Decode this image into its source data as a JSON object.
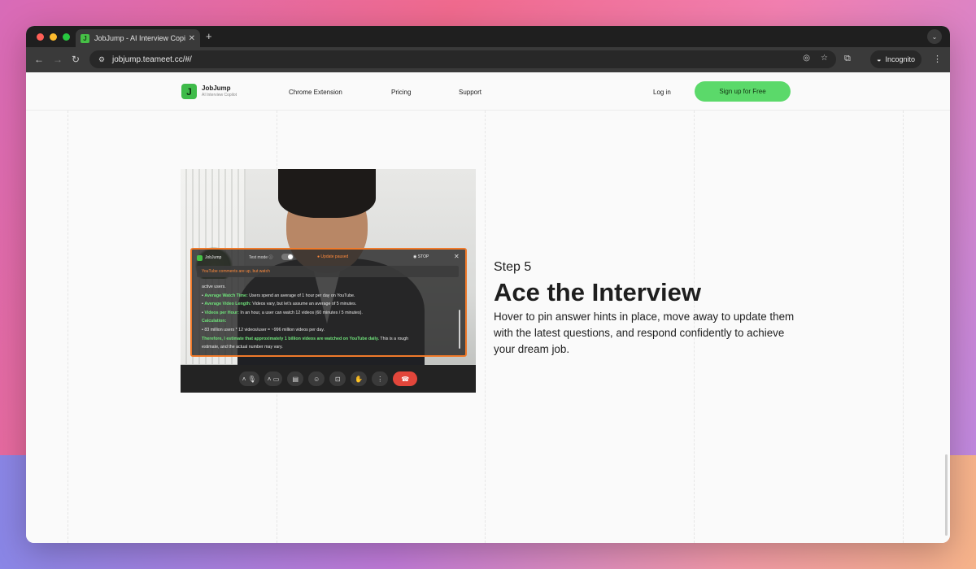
{
  "browser": {
    "tab_title": "JobJump - AI Interview Copilo",
    "url": "jobjump.teameet.cc/#/",
    "incognito_label": "Incognito"
  },
  "header": {
    "brand_name": "JobJump",
    "brand_tagline": "AI Interview Copilot",
    "nav": [
      "Chrome Extension",
      "Pricing",
      "Support"
    ],
    "login_label": "Log in",
    "signup_label": "Sign up for Free"
  },
  "overlay": {
    "brand": "JobJump",
    "test_mode_label": "Test mode",
    "status_label": "Update paused",
    "stop_label": "STOP",
    "banner_text": "YouTube comments are up, but watch",
    "lines": {
      "l1": "active users.",
      "l2_key": "Average Watch Time:",
      "l2_val": " Users spend an average of 1 hour per day on YouTube.",
      "l3_key": "Average Video Length:",
      "l3_val": " Videos vary, but let's assume an average of 5 minutes.",
      "l4_key": "Videos per Hour:",
      "l4_val": " In an hour, a user can watch 12 videos (60 minutes / 5 minutes).",
      "l5": "Calculation:",
      "l6": "83 million users * 12 videos/user = ~996 million videos per day.",
      "l7_key": "Therefore, I estimate that approximately 1 billion videos are watched on YouTube daily.",
      "l7_val": " This is a rough",
      "l8": "estimate, and the actual number may vary."
    }
  },
  "step": {
    "label": "Step 5",
    "title": "Ace the Interview",
    "description": "Hover to pin answer hints in place, move away to update them with the latest questions, and respond confidently to achieve your dream job."
  },
  "colors": {
    "accent_green": "#5bd96a",
    "overlay_border": "#f07a2a",
    "end_call_red": "#e2463b"
  }
}
